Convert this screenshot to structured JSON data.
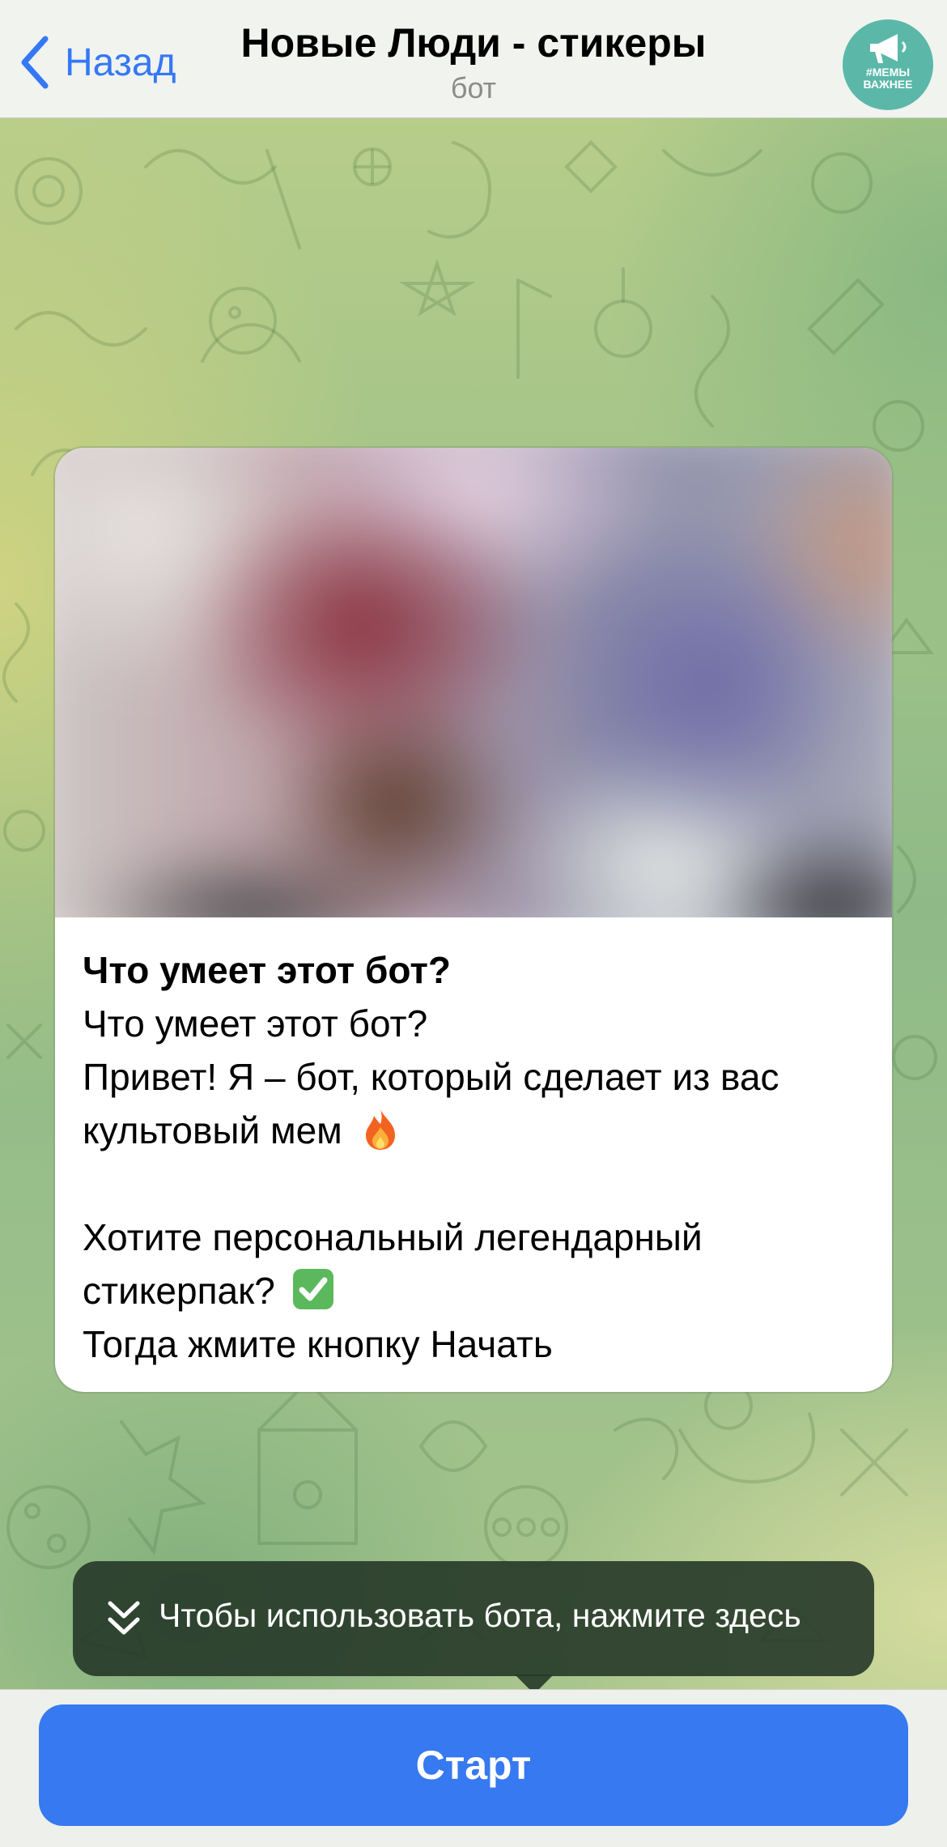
{
  "header": {
    "back_label": "Назад",
    "title": "Новые Люди - стикеры",
    "subtitle": "бот",
    "avatar_text_line1": "#МЕМЫ",
    "avatar_text_line2": "ВАЖНЕЕ"
  },
  "message": {
    "photo": "blurred-photo",
    "heading": "Что умеет этот бот?",
    "line1": "Что умеет этот бот?",
    "line2": "Привет! Я – бот, который сделает из вас",
    "line3": "культовый мем",
    "line3_emoji": "fire-emoji",
    "line4": "Хотите персональный легендарный",
    "line5": "стикерпак?",
    "line5_emoji": "check-mark-emoji",
    "line6": "Тогда жмите кнопку Начать"
  },
  "tooltip": {
    "text": "Чтобы использовать бота, нажмите здесь",
    "icon": "double-chevron-down-icon"
  },
  "bottom_bar": {
    "start_label": "Старт"
  },
  "colors": {
    "accent": "#3679f0",
    "back_link": "#3478f6",
    "tooltip_bg": "#263828",
    "avatar_bg": "#5bb8a8"
  }
}
